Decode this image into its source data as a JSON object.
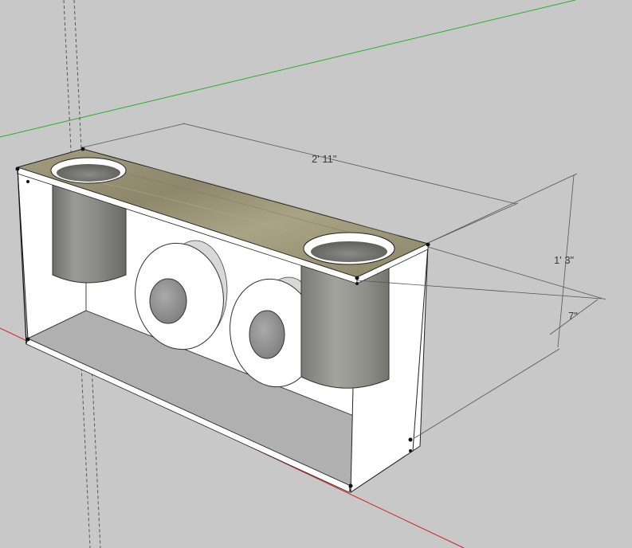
{
  "viewport": {
    "background": "#c8c8c8",
    "axes": {
      "green_axis": "#2eaa2e",
      "red_axis": "#cc2222",
      "blue_axis_dashed": "#555555"
    }
  },
  "model": {
    "box_face_color": "#ffffff",
    "box_inner_color": "#eeeeee",
    "bottom_color": "#b0b0b0",
    "top_board_color": "#9c9478",
    "port_tube_color": "#8c8c88",
    "driver_ring_color": "#ffffff",
    "driver_center_color": "#909090"
  },
  "dimensions": {
    "length": "2' 11\"",
    "height": "1' 3\"",
    "depth": "7\""
  }
}
